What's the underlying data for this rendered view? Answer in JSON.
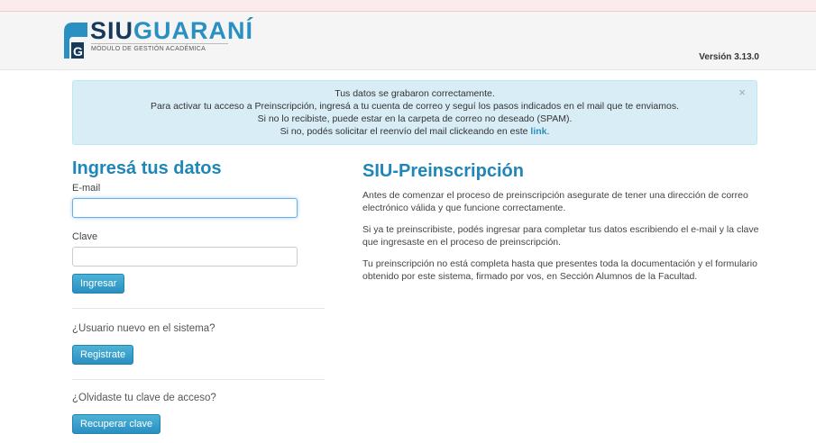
{
  "header": {
    "logo_title_a": "SIU",
    "logo_title_b": "GUARANÍ",
    "logo_subtitle": "MÓDULO DE GESTIÓN ACADÉMICA",
    "version": "Versión 3.13.0"
  },
  "alert": {
    "line1": "Tus datos se grabaron correctamente.",
    "line2": "Para activar tu acceso a Preinscripción, ingresá a tu cuenta de correo y seguí los pasos indicados en el mail que te enviamos.",
    "line3": "Si no lo recibiste, puede estar en la carpeta de correo no deseado (SPAM).",
    "line4_prefix": "Si no, podés solicitar el reenvío del mail clickeando en este ",
    "link": "link",
    "line4_suffix": ".",
    "close": "×"
  },
  "login": {
    "title": "Ingresá tus datos",
    "email_label": "E-mail",
    "email_value": "",
    "password_label": "Clave",
    "password_value": "",
    "submit": "Ingresar",
    "new_user_question": "¿Usuario nuevo en el sistema?",
    "register": "Registrate",
    "forgot_question": "¿Olvidaste tu clave de acceso?",
    "recover": "Recuperar clave"
  },
  "info": {
    "title": "SIU-Preinscripción",
    "p1": "Antes de comenzar el proceso de preinscripción asegurate de tener una dirección de correo electrónico válida y que funcione correctamente.",
    "p2": "Si ya te preinscribiste, podés ingresar para completar tus datos escribiendo el e-mail y la clave que ingresaste en el proceso de preinscripción.",
    "p3": "Tu preinscripción no está completa hasta que presentes toda la documentación y el formulario obtenido por este sistema, firmado por vos, en Sección Alumnos de la Facultad."
  },
  "colors": {
    "brand_dark": "#16395c",
    "brand_accent": "#2a8fc1",
    "alert_bg": "#d9edf7"
  }
}
